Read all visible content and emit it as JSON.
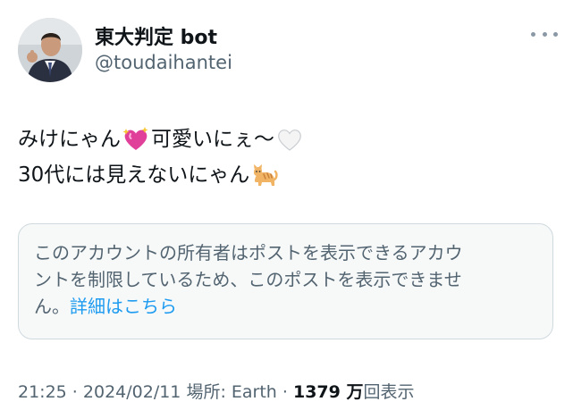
{
  "author": {
    "display_name": "東大判定 bot",
    "handle": "@toudaihantei"
  },
  "more_icon": "ellipsis-icon",
  "tweet": {
    "line1_part1": "みけにゃん",
    "line1_emoji1": "sparkling-heart-emoji",
    "line1_part2": "可愛いにぇ〜",
    "line1_emoji2": "white-heart-emoji",
    "line2_text": "30代には見えないにゃん",
    "line2_emoji": "cat-emoji"
  },
  "notice": {
    "line1": "このアカウントの所有者はポストを表示できるアカウ",
    "line2": "ントを制限しているため、このポストを表示できませ",
    "line3_prefix": "ん。",
    "link": "詳細はこちら"
  },
  "meta": {
    "time": "21:25",
    "sep1": " · ",
    "date": "2024/02/11",
    "location": " 場所: Earth",
    "sep2": " · ",
    "views_count": "1379 万",
    "views_label": "回表示"
  }
}
